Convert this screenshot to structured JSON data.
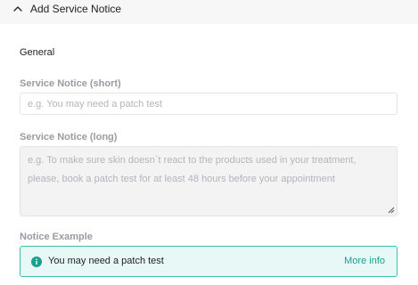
{
  "header": {
    "title": "Add Service Notice",
    "toggle_icon": "chevron-up-icon"
  },
  "section": {
    "title": "General"
  },
  "fields": {
    "short": {
      "label": "Service Notice (short)",
      "placeholder": "e.g. You may need a patch test",
      "value": ""
    },
    "long": {
      "label": "Service Notice (long)",
      "placeholder": "e.g. To make sure skin doesn`t react to the products used in your treatment, please, book a patch test for at least 48 hours before your appointment",
      "value": ""
    }
  },
  "example": {
    "label": "Notice Example",
    "icon": "info-icon",
    "text": "You may need a patch test",
    "link": "More info"
  },
  "colors": {
    "accent": "#1aa08f",
    "example_border": "#3ec2b0",
    "example_bg": "#e8f8f6",
    "label": "#9a9ba3"
  }
}
